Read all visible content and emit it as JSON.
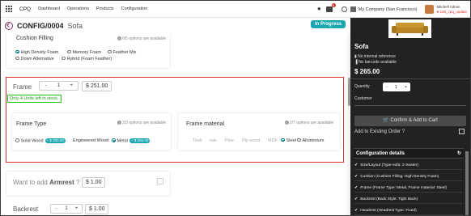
{
  "navbar": {
    "app_name": "CPQ",
    "menu": [
      "Dashboard",
      "Operations",
      "Products",
      "Configuration"
    ],
    "chat_badge": "9",
    "company": "My Company (San Francisco)",
    "user_name": "Mitchell Admin",
    "user_db": "● 158_cpq_update"
  },
  "breadcrumb": {
    "record": "CONFIG/0004",
    "product": "Sofa",
    "status": "In Progress"
  },
  "cushion": {
    "title": "Cushion Filling",
    "info": "6/5 options are available",
    "options": [
      {
        "label": "High Density Foam",
        "selected": true
      },
      {
        "label": "Memory Foam",
        "selected": false
      },
      {
        "label": "Feather Mix",
        "selected": false
      },
      {
        "label": "Down Alternative",
        "selected": false
      },
      {
        "label": "Hybrid (Foam Feather)",
        "selected": false
      }
    ]
  },
  "frame": {
    "label": "Frame",
    "qty": "1",
    "minus": "-",
    "plus": "+",
    "price": "$ 251.00",
    "stock_message": "Only 4 Units left in stock.",
    "frame_type": {
      "title": "Frame Type",
      "info": "3/3 options are available",
      "options": [
        {
          "label": "Solid Wood",
          "price": "+ $ 200.00",
          "selected": false
        },
        {
          "label": "Engineered Wood",
          "price": "",
          "selected": false
        },
        {
          "label": "Metal",
          "price": "+ $ 250.00",
          "selected": true
        }
      ]
    },
    "frame_material": {
      "title": "Frame material",
      "info": "2/7 options are available",
      "options": [
        {
          "label": "Teak",
          "disabled": true,
          "selected": false
        },
        {
          "label": "oak",
          "disabled": true,
          "selected": false
        },
        {
          "label": "Pine",
          "disabled": true,
          "selected": false
        },
        {
          "label": "Ply wood",
          "disabled": true,
          "selected": false
        },
        {
          "label": "MDF",
          "disabled": true,
          "selected": false
        },
        {
          "label": "Steel",
          "disabled": false,
          "selected": true
        },
        {
          "label": "Alluminium",
          "disabled": false,
          "selected": false
        }
      ]
    }
  },
  "armrest": {
    "question_prefix": "Want to add ",
    "question_bold": "Armrest",
    "question_suffix": " ?",
    "price": "$ 1.00"
  },
  "backrest": {
    "label": "Backrest",
    "qty": "1",
    "minus": "-",
    "plus": "+",
    "price": "$ 1.00"
  },
  "side": {
    "title": "Sofa",
    "no_internal_ref": "No internal reference",
    "no_barcode": "No barcode available",
    "price": "$ 265.00",
    "quantity_label": "Quantity",
    "qty": "1",
    "minus": "-",
    "plus": "+",
    "customer_label": "Customer",
    "confirm_label": "🛒 Confirm & Add to Cart",
    "existing_label": "Add to Existing Order ?",
    "config_header": "Configuration details",
    "config_items": [
      "Size/Layout (Type-sofa: 2-Seater)",
      "Cushion (Cushion Filling: High Density Foam)",
      "Frame (Frame Type: Metal, Frame material: Steel)",
      "Backrest (Back Style: Tight Back)",
      "Headrest (Headrest Type: Fixed)"
    ]
  }
}
